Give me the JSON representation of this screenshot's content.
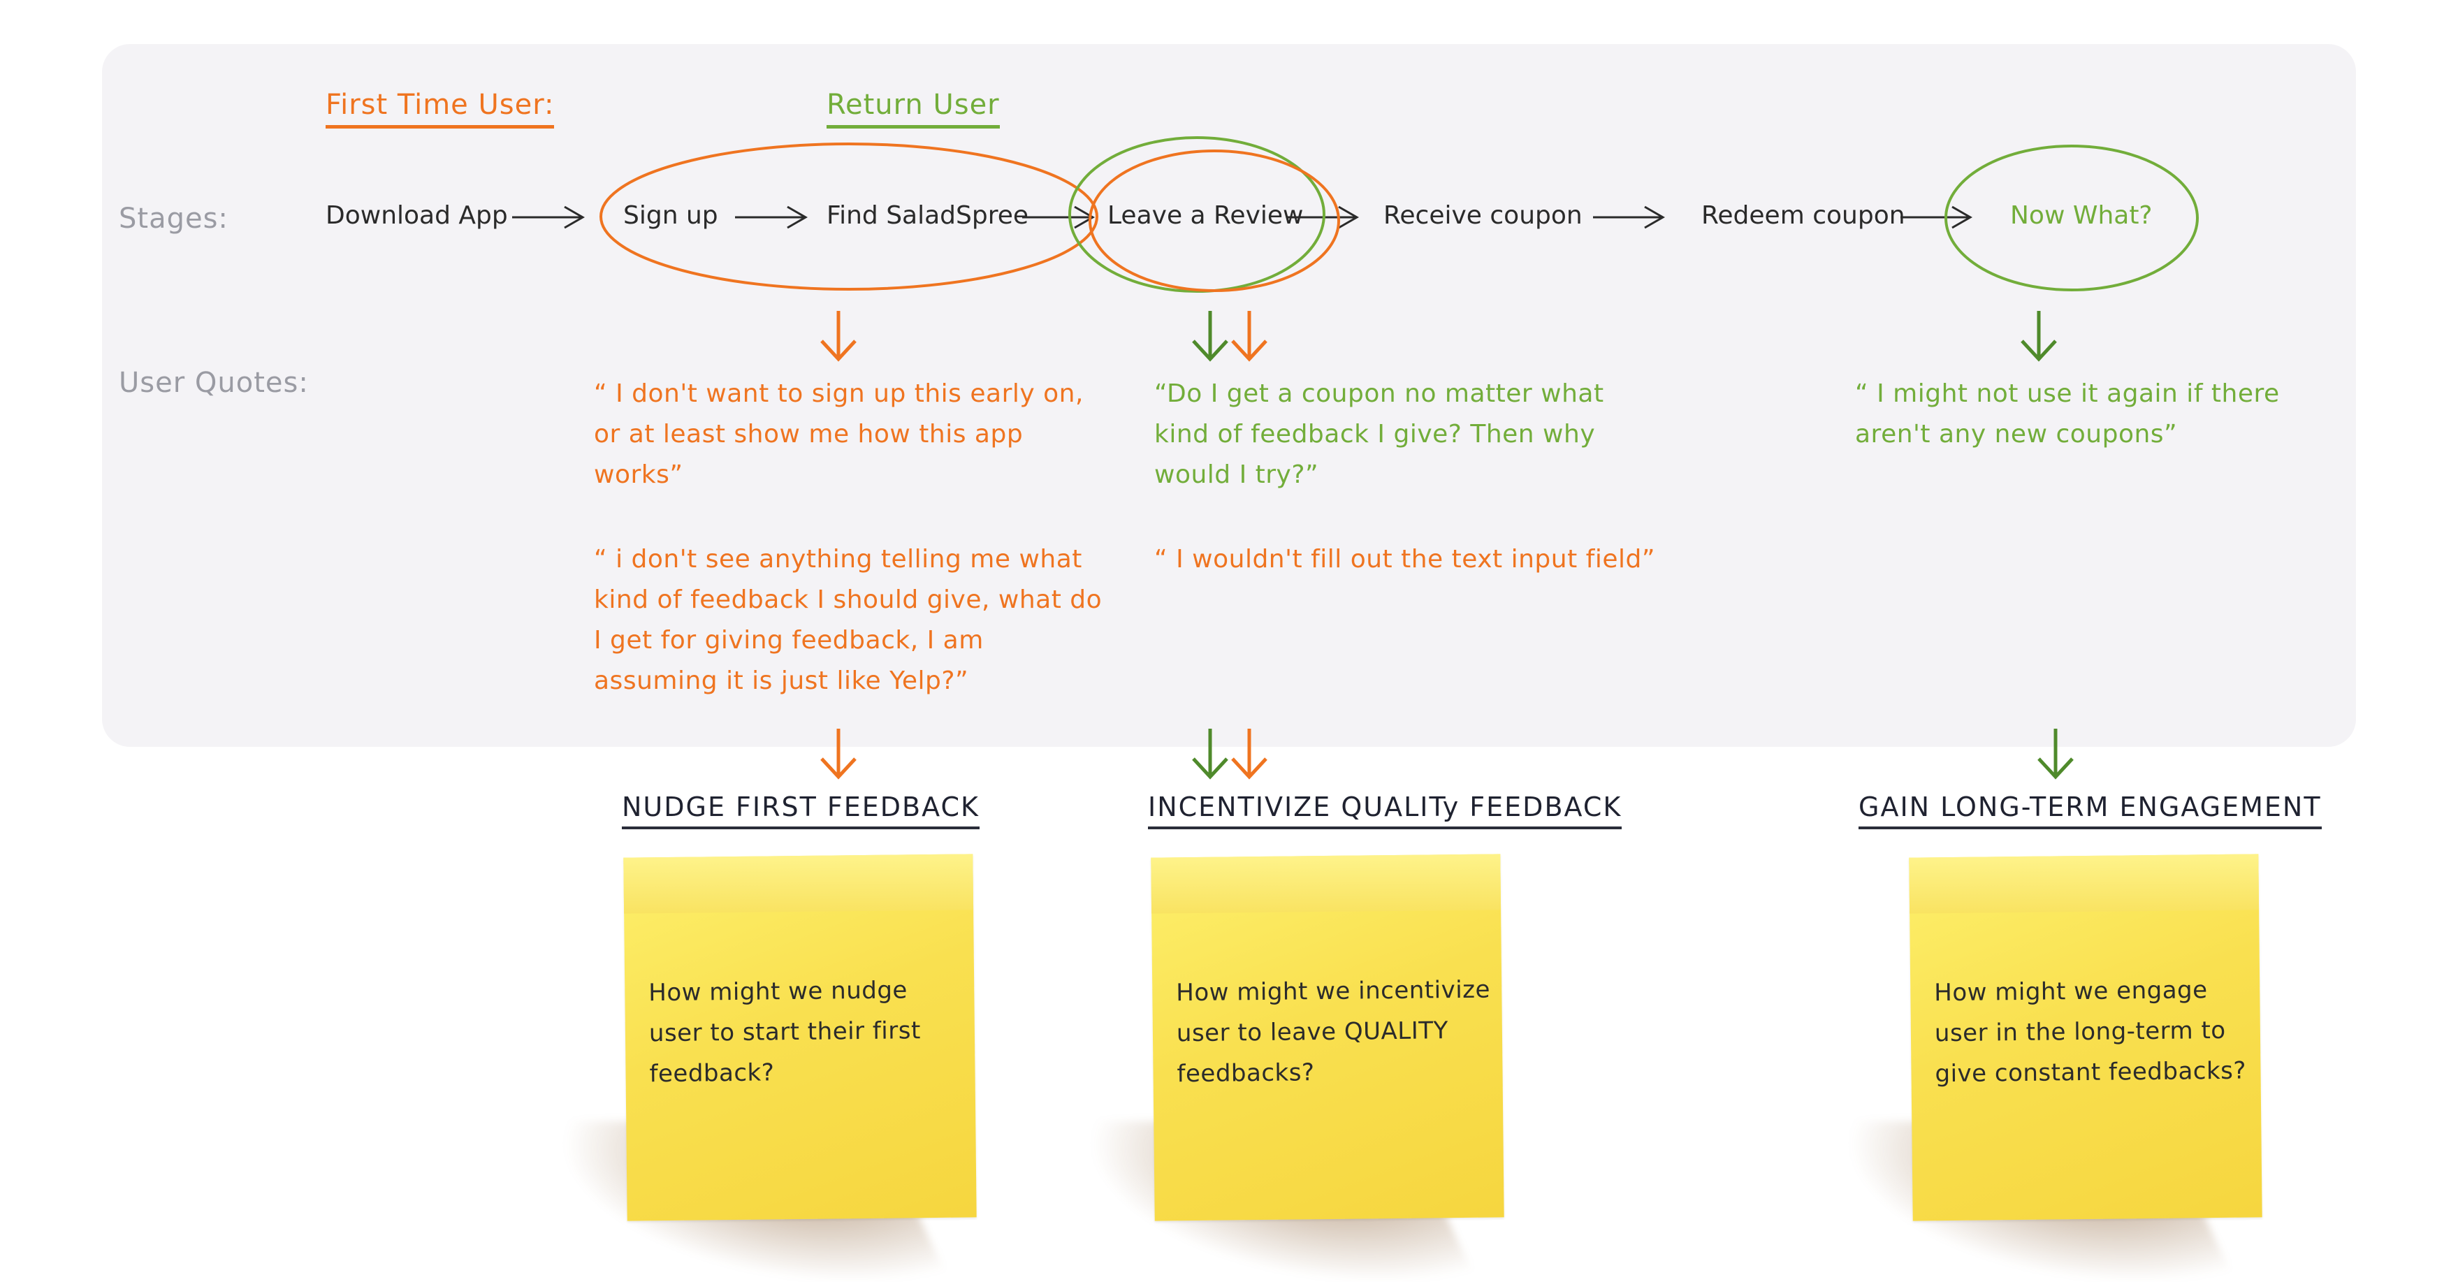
{
  "legend": {
    "first_time": "First Time User:",
    "return": "Return User"
  },
  "row_labels": {
    "stages": "Stages:",
    "quotes": "User Quotes:"
  },
  "stages": [
    "Download App",
    "Sign up",
    "Find SaladSpree",
    "Leave a Review",
    "Receive coupon",
    "Redeem coupon",
    "Now What?"
  ],
  "quotes": {
    "signup_1": "“ I don't want to sign up this early on, or at least show me how this app works”",
    "signup_2": "“ i don't see anything telling me what kind of feedback I should give, what do I get for giving feedback, I am assuming it is just like Yelp?”",
    "review_1": "“Do I get a coupon no matter what kind of feedback I give? Then why would I try?”",
    "review_2": "“ I wouldn't fill out the text input field”",
    "nowwhat_1": "“ I might not use it again if there aren't any new coupons”"
  },
  "opportunities": [
    {
      "title": "NUDGE FIRST FEEDBACK",
      "note": "How might we nudge user to start their first feedback?"
    },
    {
      "title": "INCENTIVIZE QUALITy FEEDBACK",
      "note": "How might we incentivize user to leave QUALITY feedbacks?"
    },
    {
      "title": "GAIN LONG-TERM ENGAGEMENT",
      "note": "How might we engage user in the long-term to give constant feedbacks?"
    }
  ],
  "colors": {
    "first_time": "#ef7420",
    "return": "#72ad3a",
    "arrow_green": "#4f8a2b",
    "sticky": "#f9e050",
    "panel": "#f4f3f6"
  }
}
